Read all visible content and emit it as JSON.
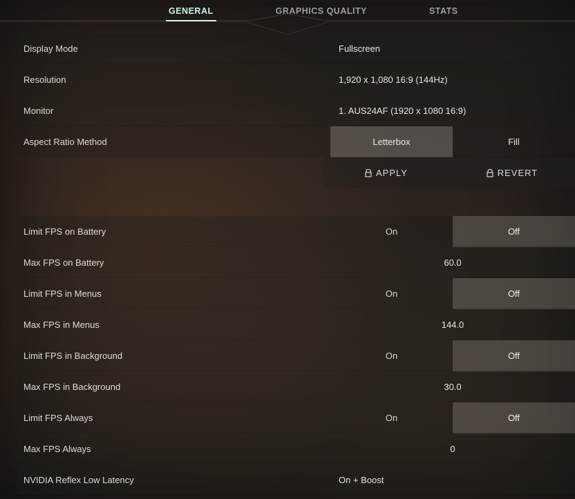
{
  "tabs": {
    "general": "GENERAL",
    "graphics": "GRAPHICS QUALITY",
    "stats": "STATS",
    "active": "general"
  },
  "display": {
    "mode_label": "Display Mode",
    "mode_value": "Fullscreen",
    "resolution_label": "Resolution",
    "resolution_value": "1,920 x 1,080 16:9 (144Hz)",
    "monitor_label": "Monitor",
    "monitor_value": "1. AUS24AF (1920 x  1080 16:9)",
    "aspect_label": "Aspect Ratio Method",
    "aspect_options": {
      "letterbox": "Letterbox",
      "fill": "Fill"
    },
    "aspect_selected": "letterbox"
  },
  "actions": {
    "apply": "APPLY",
    "revert": "REVERT"
  },
  "common": {
    "on": "On",
    "off": "Off"
  },
  "fps": {
    "limit_battery_label": "Limit FPS on Battery",
    "limit_battery_selected": "off",
    "max_battery_label": "Max FPS on Battery",
    "max_battery_value": "60.0",
    "limit_menus_label": "Limit FPS in Menus",
    "limit_menus_selected": "off",
    "max_menus_label": "Max FPS in Menus",
    "max_menus_value": "144.0",
    "limit_background_label": "Limit FPS in Background",
    "limit_background_selected": "off",
    "max_background_label": "Max FPS in Background",
    "max_background_value": "30.0",
    "limit_always_label": "Limit FPS Always",
    "limit_always_selected": "off",
    "max_always_label": "Max FPS Always",
    "max_always_value": "0",
    "reflex_label": "NVIDIA Reflex Low Latency",
    "reflex_value": "On + Boost"
  }
}
